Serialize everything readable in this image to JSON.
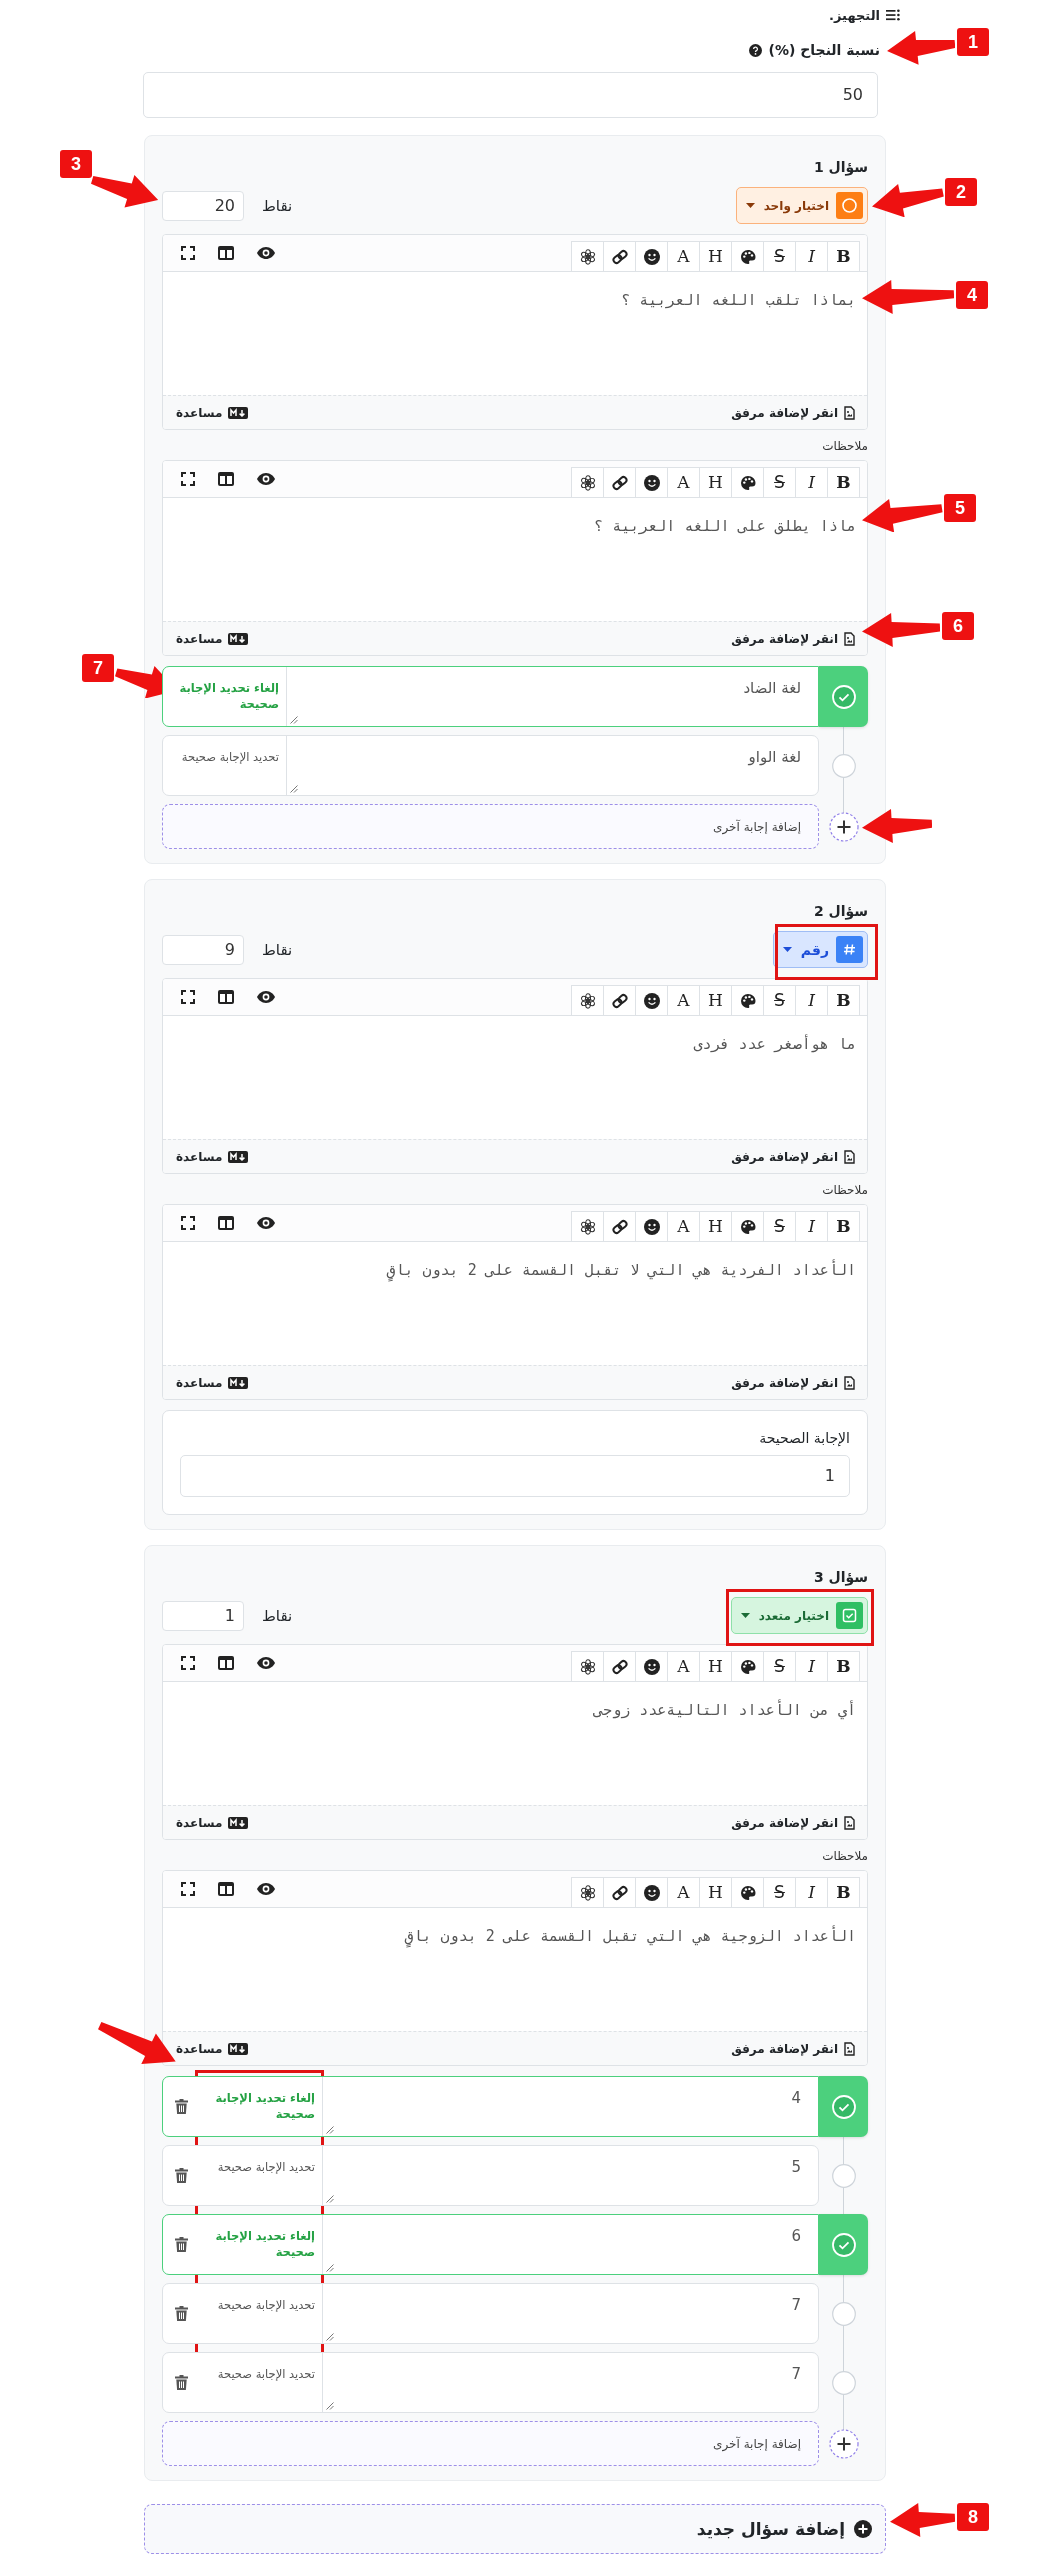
{
  "header": {
    "title": "التجهيز."
  },
  "passing_rate": {
    "label": "نسبة النجاح (%)",
    "value": "50"
  },
  "questions": [
    {
      "title": "سؤال 1",
      "type": {
        "kind": "single",
        "label": "اختيار واحد"
      },
      "points": {
        "label": "نقاط",
        "value": "20"
      },
      "editor": {
        "toolbar": [
          {
            "kind": "bold",
            "label": "B"
          },
          {
            "kind": "italic",
            "label": "I"
          },
          {
            "kind": "strike",
            "label": "S"
          },
          {
            "kind": "palette"
          },
          {
            "kind": "heading",
            "label": "H"
          },
          {
            "kind": "font",
            "label": "A"
          },
          {
            "kind": "emoji"
          },
          {
            "kind": "link"
          },
          {
            "kind": "ai"
          }
        ],
        "text": "بماذا تلقب اللغه العربية ؟",
        "attach": "انقر لإضافة مرفق",
        "help": "مساعدة"
      },
      "notes": {
        "label": "ملاحظات",
        "toolbar": [
          {
            "kind": "bold",
            "label": "B"
          },
          {
            "kind": "italic",
            "label": "I"
          },
          {
            "kind": "strike",
            "label": "S"
          },
          {
            "kind": "palette"
          },
          {
            "kind": "heading",
            "label": "H"
          },
          {
            "kind": "font",
            "label": "A"
          },
          {
            "kind": "emoji"
          },
          {
            "kind": "link"
          },
          {
            "kind": "ai"
          }
        ],
        "text": "ماذا يطلق على اللغه العربية ؟",
        "attach": "انقر لإضافة مرفق",
        "help": "مساعدة"
      },
      "answers": [
        {
          "text": "لغة الضاد",
          "correct": true,
          "removable": false,
          "toggle": "إلغاء تحديد الإجابة صحيحة"
        },
        {
          "text": "لغة الواو",
          "correct": false,
          "removable": false,
          "toggle": "تحديد الإجابة صحيحة"
        }
      ],
      "add_answer": "إضافة إجابة آخرى"
    },
    {
      "title": "سؤال 2",
      "type": {
        "kind": "number",
        "label": "رقم"
      },
      "points": {
        "label": "نقاط",
        "value": "9"
      },
      "editor": {
        "toolbar": [
          {
            "kind": "bold",
            "label": "B"
          },
          {
            "kind": "italic",
            "label": "I"
          },
          {
            "kind": "strike",
            "label": "S"
          },
          {
            "kind": "palette"
          },
          {
            "kind": "heading",
            "label": "H"
          },
          {
            "kind": "font",
            "label": "A"
          },
          {
            "kind": "emoji"
          },
          {
            "kind": "link"
          },
          {
            "kind": "ai"
          }
        ],
        "text": "ما هوأصغر عدد فردى",
        "attach": "انقر لإضافة مرفق",
        "help": "مساعدة"
      },
      "notes": {
        "label": "ملاحظات",
        "toolbar": [
          {
            "kind": "bold",
            "label": "B"
          },
          {
            "kind": "italic",
            "label": "I"
          },
          {
            "kind": "strike",
            "label": "S"
          },
          {
            "kind": "palette"
          },
          {
            "kind": "heading",
            "label": "H"
          },
          {
            "kind": "font",
            "label": "A"
          },
          {
            "kind": "emoji"
          },
          {
            "kind": "link"
          },
          {
            "kind": "ai"
          }
        ],
        "text": "الأعداد الفردية هي التي لا تقبل القسمة على 2 بدون باقٍ",
        "attach": "انقر لإضافة مرفق",
        "help": "مساعدة"
      },
      "correct_answer": {
        "label": "الإجابة الصحيحة",
        "value": "1"
      }
    },
    {
      "title": "سؤال 3",
      "type": {
        "kind": "multiple",
        "label": "اختيار متعدد"
      },
      "points": {
        "label": "نقاط",
        "value": "1"
      },
      "editor": {
        "toolbar": [
          {
            "kind": "bold",
            "label": "B"
          },
          {
            "kind": "italic",
            "label": "I"
          },
          {
            "kind": "strike",
            "label": "S"
          },
          {
            "kind": "palette"
          },
          {
            "kind": "heading",
            "label": "H"
          },
          {
            "kind": "font",
            "label": "A"
          },
          {
            "kind": "emoji"
          },
          {
            "kind": "link"
          },
          {
            "kind": "ai"
          }
        ],
        "text": "أي من الأعداد التاليةعدد زوجى",
        "attach": "انقر لإضافة مرفق",
        "help": "مساعدة"
      },
      "notes": {
        "label": "ملاحظات",
        "toolbar": [
          {
            "kind": "bold",
            "label": "B"
          },
          {
            "kind": "italic",
            "label": "I"
          },
          {
            "kind": "strike",
            "label": "S"
          },
          {
            "kind": "palette"
          },
          {
            "kind": "heading",
            "label": "H"
          },
          {
            "kind": "font",
            "label": "A"
          },
          {
            "kind": "emoji"
          },
          {
            "kind": "link"
          },
          {
            "kind": "ai"
          }
        ],
        "text": "الأعداد الزوجية هي التي تقبل القسمة على 2 بدون باقٍ",
        "attach": "انقر لإضافة مرفق",
        "help": "مساعدة"
      },
      "answers": [
        {
          "text": "4",
          "correct": true,
          "removable": true,
          "toggle": "إلغاء تحديد الإجابة صحيحة"
        },
        {
          "text": "5",
          "correct": false,
          "removable": true,
          "toggle": "تحديد الإجابة صحيحة"
        },
        {
          "text": "6",
          "correct": true,
          "removable": true,
          "toggle": "إلغاء تحديد الإجابة صحيحة"
        },
        {
          "text": "7",
          "correct": false,
          "removable": true,
          "toggle": "تحديد الإجابة صحيحة"
        },
        {
          "text": "7",
          "correct": false,
          "removable": true,
          "toggle": "تحديد الإجابة صحيحة"
        }
      ],
      "add_answer": "إضافة إجابة آخرى"
    }
  ],
  "add_question": "إضافة سؤال جديد",
  "annotations": [
    {
      "kind": "callout",
      "label": "1"
    },
    {
      "kind": "callout",
      "label": "2"
    },
    {
      "kind": "callout",
      "label": "3"
    },
    {
      "kind": "callout",
      "label": "4"
    },
    {
      "kind": "callout",
      "label": "5"
    },
    {
      "kind": "callout",
      "label": "6"
    },
    {
      "kind": "callout",
      "label": "7"
    },
    {
      "kind": "callout",
      "label": "8"
    },
    {
      "kind": "arrow"
    },
    {
      "kind": "arrow"
    },
    {
      "kind": "highlight"
    },
    {
      "kind": "highlight"
    },
    {
      "kind": "highlight"
    }
  ]
}
